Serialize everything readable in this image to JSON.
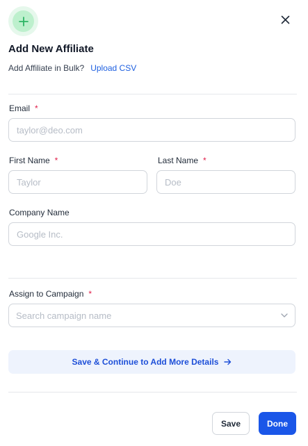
{
  "header": {
    "icon": "plus-icon",
    "title": "Add New Affiliate",
    "bulk_text": "Add Affiliate in Bulk?",
    "bulk_link": "Upload CSV",
    "close_icon": "close-icon"
  },
  "form": {
    "email": {
      "label": "Email",
      "required_mark": "*",
      "placeholder": "taylor@deo.com",
      "value": ""
    },
    "first_name": {
      "label": "First Name",
      "required_mark": "*",
      "placeholder": "Taylor",
      "value": ""
    },
    "last_name": {
      "label": "Last Name",
      "required_mark": "*",
      "placeholder": "Doe",
      "value": ""
    },
    "company_name": {
      "label": "Company Name",
      "placeholder": "Google Inc.",
      "value": ""
    },
    "campaign": {
      "label": "Assign to Campaign",
      "required_mark": "*",
      "placeholder": "Search campaign name",
      "icon": "chevron-down-icon"
    }
  },
  "actions": {
    "continue_label": "Save & Continue to Add More Details",
    "continue_icon": "arrow-right-icon",
    "save_label": "Save",
    "done_label": "Done"
  },
  "colors": {
    "accent": "#1a56e8",
    "link": "#1d5fe0",
    "icon_green": "#2db565",
    "required": "#e11d48"
  }
}
